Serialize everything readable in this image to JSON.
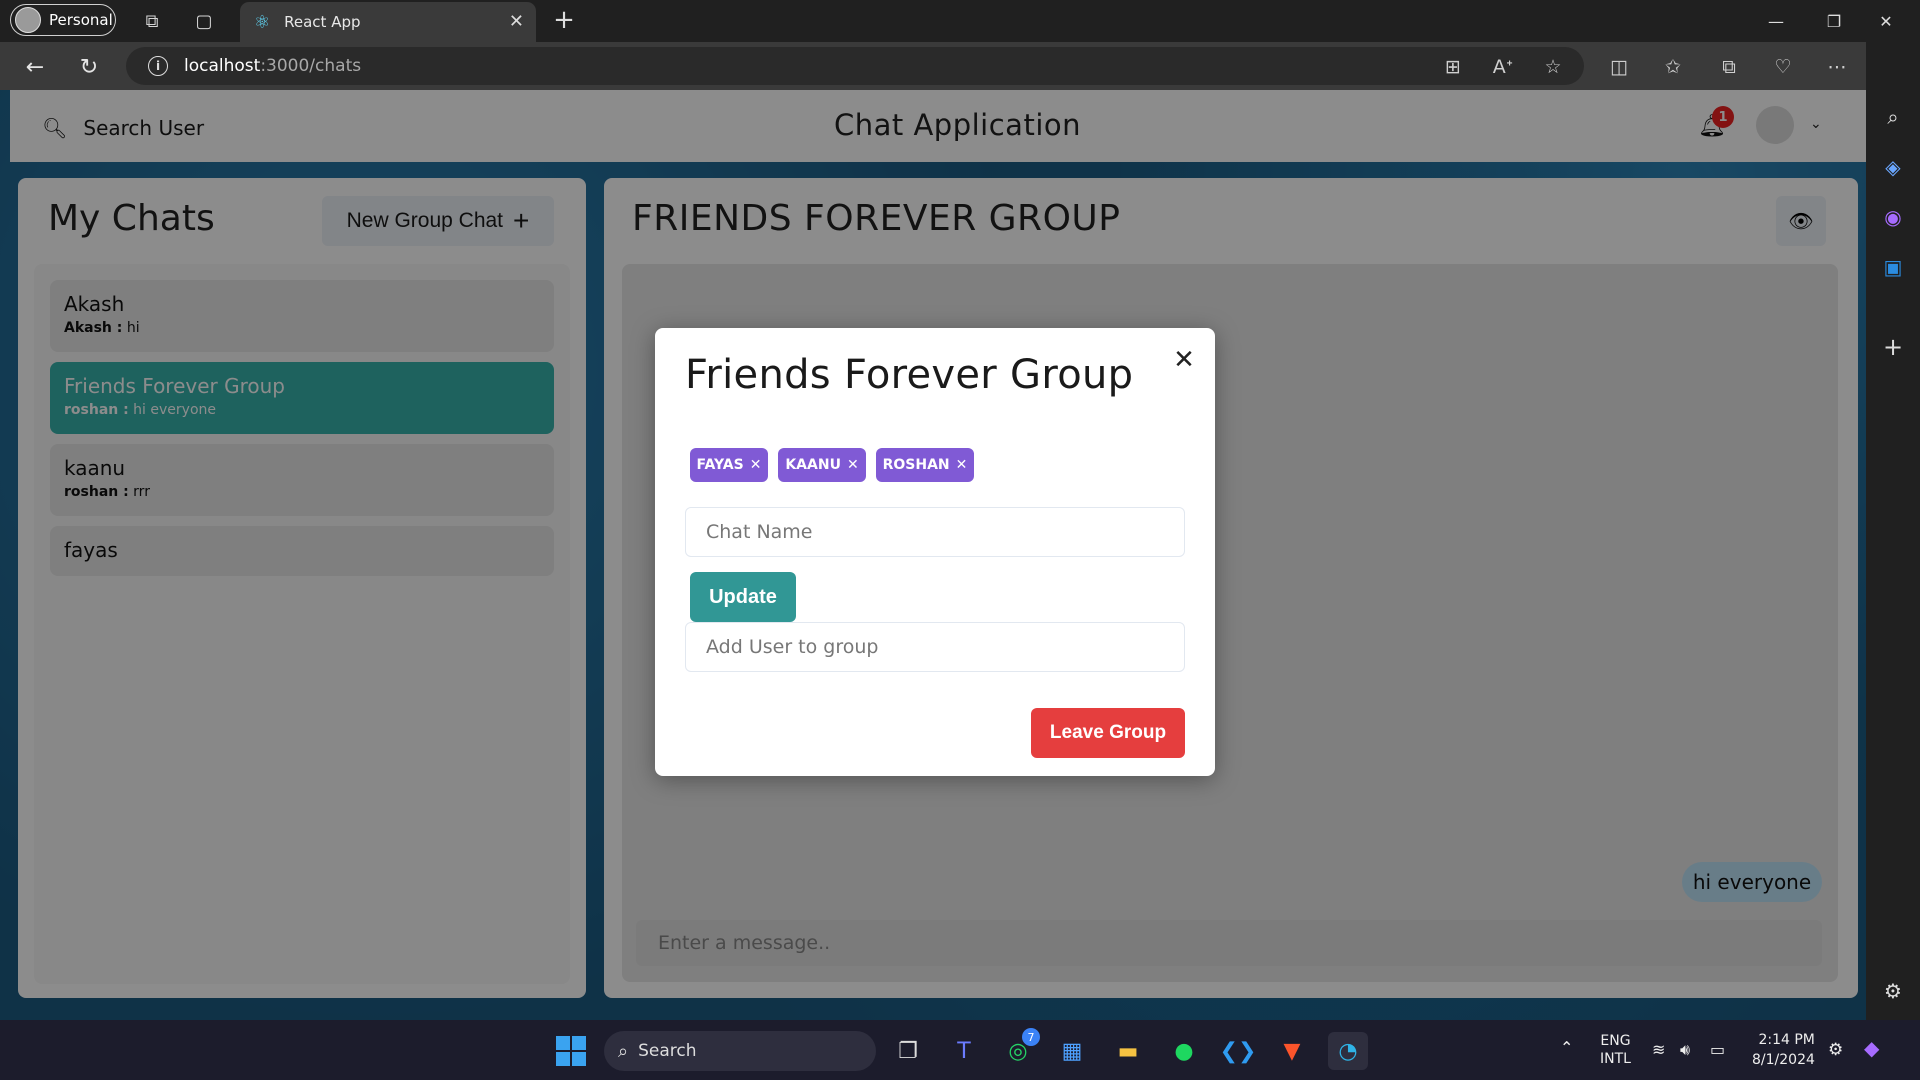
{
  "browser": {
    "profile_label": "Personal",
    "tab_title": "React App",
    "url_host": "localhost",
    "url_path": ":3000/chats"
  },
  "header": {
    "search_label": "Search User",
    "app_title": "Chat Application",
    "notification_count": "1"
  },
  "left_panel": {
    "title": "My Chats",
    "new_group_label": "New Group Chat",
    "chats": [
      {
        "name": "Akash",
        "sender": "Akash :",
        "message": "hi"
      },
      {
        "name": "Friends Forever Group",
        "sender": "roshan :",
        "message": "hi everyone"
      },
      {
        "name": "kaanu",
        "sender": "roshan :",
        "message": "rrr"
      },
      {
        "name": "fayas"
      }
    ]
  },
  "chat": {
    "title": "FRIENDS FOREVER GROUP",
    "bubble_text": "hi everyone",
    "input_placeholder": "Enter a message.."
  },
  "modal": {
    "title": "Friends Forever Group",
    "members": [
      "FAYAS",
      "KAANU",
      "ROSHAN"
    ],
    "chat_name_placeholder": "Chat Name",
    "update_label": "Update",
    "add_user_placeholder": "Add User to group",
    "leave_label": "Leave Group"
  },
  "taskbar": {
    "search_label": "Search",
    "whatsapp_badge": "7",
    "lang_line1": "ENG",
    "lang_line2": "INTL",
    "time": "2:14 PM",
    "date": "8/1/2024"
  },
  "colors": {
    "accent_teal": "#38b2ac",
    "chip_purple": "#805ad5",
    "leave_red": "#e53e3e"
  }
}
